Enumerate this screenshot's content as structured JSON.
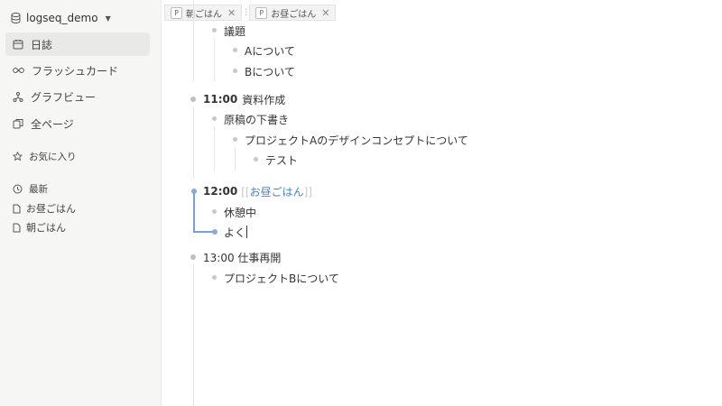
{
  "sidebar": {
    "graph_name": "logseq_demo",
    "nav": [
      {
        "label": "日誌",
        "icon": "calendar-icon"
      },
      {
        "label": "フラッシュカード",
        "icon": "infinity-icon"
      },
      {
        "label": "グラフビュー",
        "icon": "graph-icon"
      },
      {
        "label": "全ページ",
        "icon": "pages-icon"
      }
    ],
    "favorites_label": "お気に入り",
    "recent_label": "最新",
    "recent_items": [
      "お昼ごはん",
      "朝ごはん"
    ]
  },
  "tabs": [
    {
      "badge": "P",
      "label": "朝ごはん"
    },
    {
      "badge": "P",
      "label": "お昼ごはん"
    }
  ],
  "outline": {
    "b1": "議題",
    "b1a": "Aについて",
    "b1b": "Bについて",
    "b2_time": "11:00",
    "b2_text": "資料作成",
    "b2a": "原稿の下書き",
    "b2a1": "プロジェクトAのデザインコンセプトについて",
    "b2a1a": "テスト",
    "b3_time": "12:00",
    "b3_ref": "お昼ごはん",
    "b3_open": "[[",
    "b3_close": "]]",
    "b3a": "休憩中",
    "b3b": "よく",
    "b4": "13:00 仕事再開",
    "b4a": "プロジェクトBについて"
  }
}
